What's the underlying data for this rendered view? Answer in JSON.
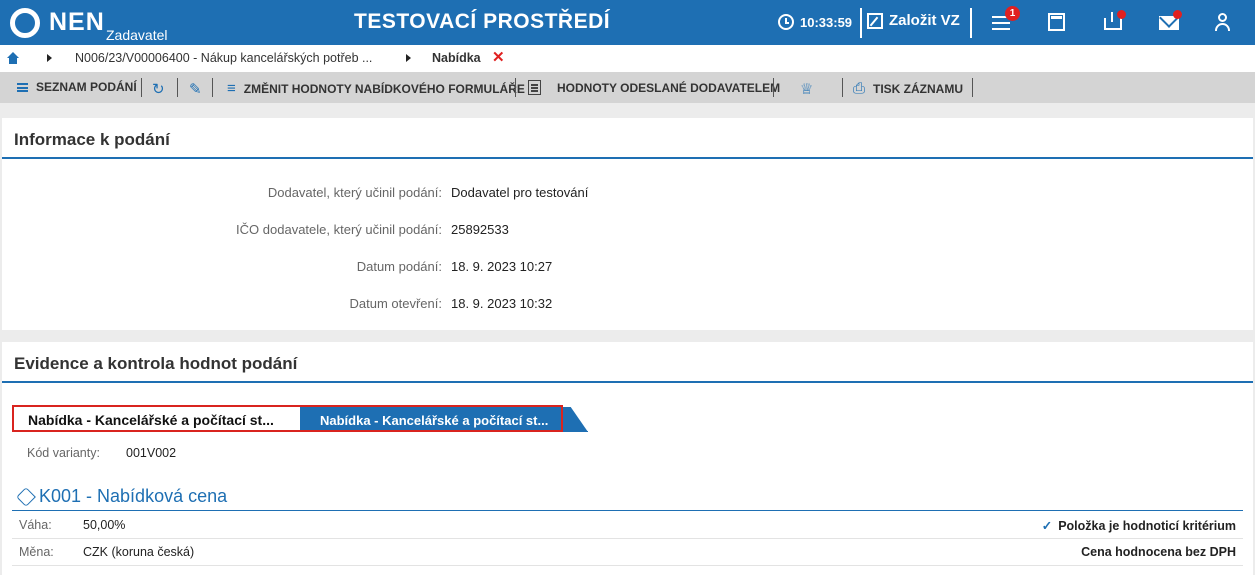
{
  "app": {
    "logo": "NEN",
    "logo_sub": "Zadavatel",
    "env_title": "TESTOVACÍ PROSTŘEDÍ",
    "time": "10:33:59",
    "create_label": "Založit VZ",
    "notification_count": "1",
    "accent_color": "#1e6fb3",
    "alert_color": "#e02020"
  },
  "breadcrumb": {
    "items": [
      "N006/23/V00006400 - Nákup kancelářských potřeb ...",
      "Nabídka"
    ]
  },
  "toolbar": {
    "list_label": "SEZNAM PODÁNÍ",
    "change_label": "ZMĚNIT HODNOTY NABÍDKOVÉHO FORMULÁŘE",
    "sent_values_label": "HODNOTY ODESLANÉ DODAVATELEM",
    "print_label": "TISK ZÁZNAMU"
  },
  "info_panel": {
    "title": "Informace k podání",
    "rows": [
      {
        "label": "Dodavatel, který učinil podání:",
        "value": "Dodavatel pro testování"
      },
      {
        "label": "IČO dodavatele, který učinil podání:",
        "value": "25892533"
      },
      {
        "label": "Datum podání:",
        "value": "18. 9. 2023 10:27"
      },
      {
        "label": "Datum otevření:",
        "value": "18. 9. 2023 10:32"
      }
    ]
  },
  "evidence_panel": {
    "title": "Evidence a kontrola hodnot podání",
    "tabs": [
      "Nabídka - Kancelářské a počítací st...",
      "Nabídka - Kancelářské a počítací st..."
    ],
    "variant_label": "Kód varianty:",
    "variant_value": "001V002",
    "criterion_title": "K001 - Nabídková cena",
    "weight_label": "Váha:",
    "weight_value": "50,00%",
    "currency_label": "Měna:",
    "currency_value": "CZK (koruna česká)",
    "criterion_flag": "Položka je hodnoticí kritérium",
    "price_note": "Cena hodnocena bez DPH"
  }
}
